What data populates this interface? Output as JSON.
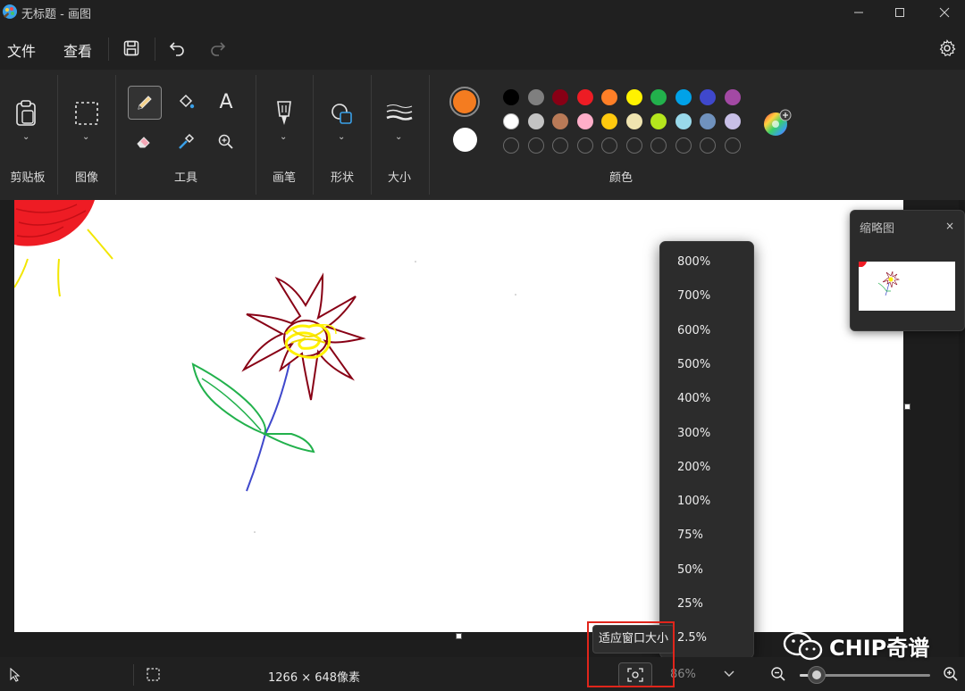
{
  "titlebar": {
    "title": "无标题 - 画图",
    "minimize": "minimize-icon",
    "maximize": "maximize-icon",
    "close": "close-icon"
  },
  "menu": {
    "file": "文件",
    "view": "查看"
  },
  "ribbon": {
    "groups": {
      "clipboard": "剪贴板",
      "image": "图像",
      "tools": "工具",
      "brushes": "画笔",
      "shapes": "形状",
      "size": "大小",
      "colors": "颜色"
    },
    "text_tool_glyph": "A",
    "primary_color": "#f47c20",
    "secondary_color": "#ffffff",
    "palette_row1": [
      "#000000",
      "#7f7f7f",
      "#880015",
      "#ed1c24",
      "#ff7f27",
      "#fff200",
      "#22b14c",
      "#00a2e8",
      "#3f48cc",
      "#a349a4"
    ],
    "palette_row2": [
      "#ffffff",
      "#c3c3c3",
      "#b97a57",
      "#ffaec9",
      "#ffc90e",
      "#efe4b0",
      "#b5e61d",
      "#99d9ea",
      "#7092be",
      "#c8bfe7"
    ]
  },
  "thumbnail": {
    "title": "缩略图",
    "close": "×"
  },
  "zoom_menu": {
    "options": [
      "800%",
      "700%",
      "600%",
      "500%",
      "400%",
      "300%",
      "200%",
      "100%",
      "75%",
      "50%",
      "25%",
      "2.5%"
    ]
  },
  "statusbar": {
    "dimensions": "1266 × 648像素",
    "tooltip": "适应窗口大小",
    "zoom_value": "86%",
    "zoom_slider_fraction": 0.13
  },
  "watermark": "CHIP奇谱"
}
